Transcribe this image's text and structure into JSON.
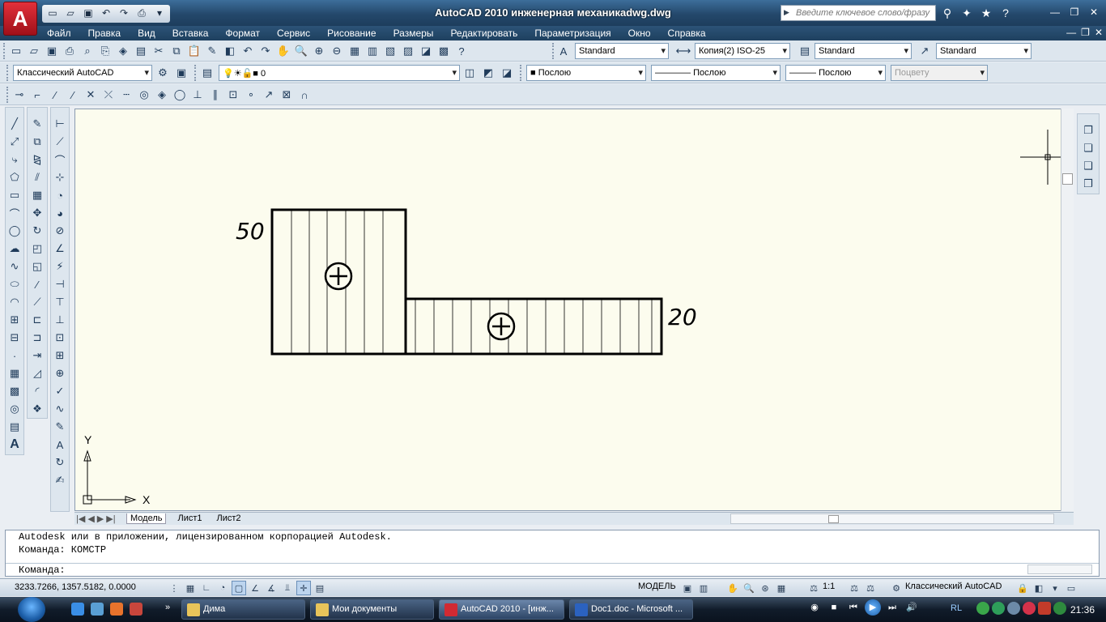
{
  "window": {
    "app_logo": "A",
    "title": "AutoCAD 2010    инженерная механикаdwg.dwg",
    "search_placeholder": "Введите ключевое слово/фразу"
  },
  "menu": [
    "Файл",
    "Правка",
    "Вид",
    "Вставка",
    "Формат",
    "Сервис",
    "Рисование",
    "Размеры",
    "Редактировать",
    "Параметризация",
    "Окно",
    "Справка"
  ],
  "styles_toolbar": {
    "text_style": "Standard",
    "dim_style": "Копия(2) ISO-25",
    "table_style": "Standard",
    "mleader_style": "Standard"
  },
  "layers_toolbar": {
    "workspace": "Классический AutoCAD",
    "layer": "0",
    "color": "Послою",
    "linetype": "Послою",
    "lineweight": "Послою",
    "plotstyle": "Поцвету"
  },
  "drawing": {
    "dim_left": "50",
    "dim_right": "20",
    "ucs_x": "X",
    "ucs_y": "Y"
  },
  "tabs": [
    "Модель",
    "Лист1",
    "Лист2"
  ],
  "command": {
    "lines": [
      "Autodesk или в приложении, лицензированном корпорацией Autodesk.",
      "Команда: КОМСТР"
    ],
    "prompt": "Команда:"
  },
  "status": {
    "coords": "3233.7266, 1357.5182, 0.0000",
    "model": "МОДЕЛЬ",
    "scale": "1:1",
    "workspace": "Классический AutoCAD"
  },
  "taskbar": {
    "buttons": [
      "Дима",
      "Мои документы",
      "AutoCAD 2010 - [инж...",
      "Doc1.doc - Microsoft ..."
    ],
    "lang": "RL",
    "clock": "21:36"
  }
}
